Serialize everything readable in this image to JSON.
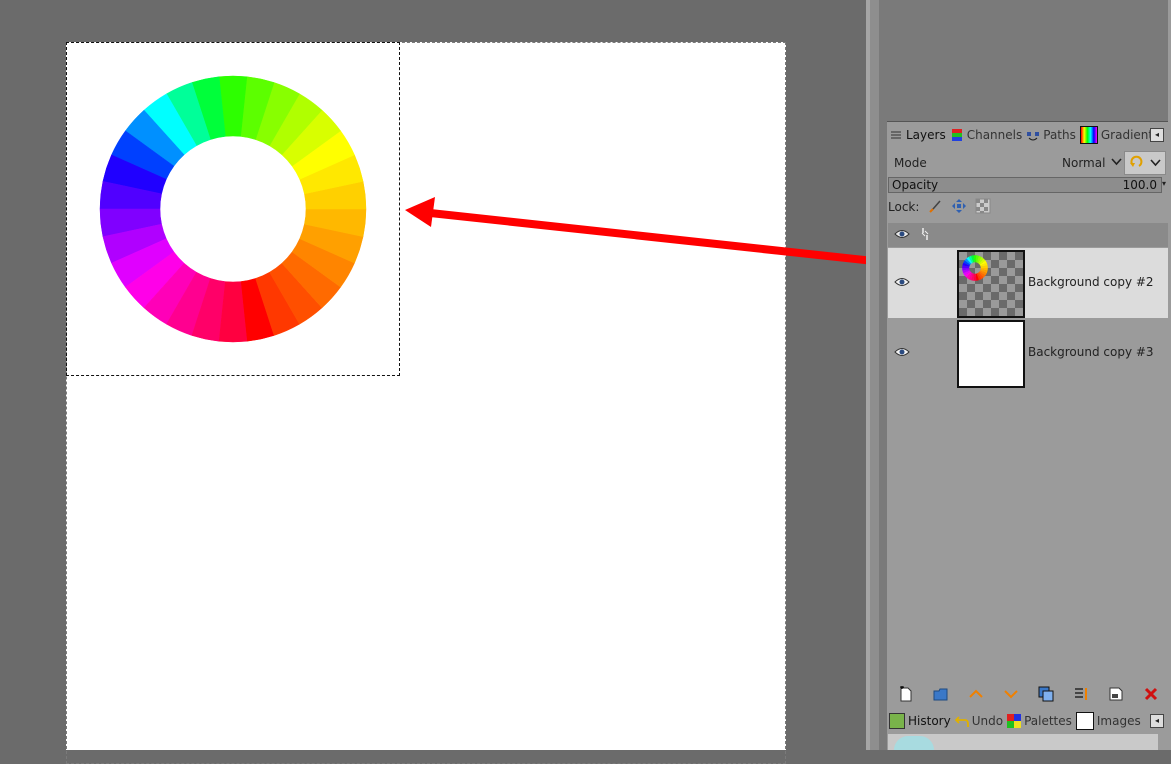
{
  "canvas": {
    "wheel_colors": [
      "#ff0000",
      "#ff3800",
      "#ff4f00",
      "#ff6a00",
      "#ff8500",
      "#ffa000",
      "#ffb800",
      "#ffd000",
      "#ffe800",
      "#ffff00",
      "#d8ff00",
      "#b0ff00",
      "#88ff00",
      "#5cff00",
      "#2dff00",
      "#00ff3a",
      "#00ff99",
      "#00ffff",
      "#0090ff",
      "#0040ff",
      "#2000ff",
      "#5000ff",
      "#8000ff",
      "#b000ff",
      "#e000ff",
      "#ff00e8",
      "#ff00b8",
      "#ff0090",
      "#ff0068",
      "#ff0040"
    ],
    "arrow_color": "#ff0000"
  },
  "layers_panel": {
    "tabs": [
      {
        "label": "Layers",
        "icon": "layers-icon"
      },
      {
        "label": "Channels",
        "icon": "channels-icon"
      },
      {
        "label": "Paths",
        "icon": "paths-icon"
      },
      {
        "label": "Gradients",
        "icon": "gradients-icon"
      }
    ],
    "mode_label": "Mode",
    "mode_value": "Normal",
    "opacity_label": "Opacity",
    "opacity_value": "100.0",
    "lock_label": "Lock:",
    "layers": [
      {
        "name": "Background copy #2",
        "selected": true,
        "visible": true,
        "thumbnail": "color-wheel"
      },
      {
        "name": "Background copy #3",
        "selected": false,
        "visible": true,
        "thumbnail": "white"
      }
    ],
    "buttons": [
      "new-layer-icon",
      "new-layer-group-icon",
      "raise-layer-icon",
      "lower-layer-icon",
      "duplicate-layer-icon",
      "anchor-layer-icon",
      "layer-to-image-size-icon",
      "delete-layer-icon"
    ]
  },
  "history_panel": {
    "tabs": [
      {
        "label": "History",
        "icon": "history-icon"
      },
      {
        "label": "Undo",
        "icon": "undo-icon"
      },
      {
        "label": "Palettes",
        "icon": "palettes-icon"
      },
      {
        "label": "Images",
        "icon": "images-icon"
      }
    ]
  }
}
